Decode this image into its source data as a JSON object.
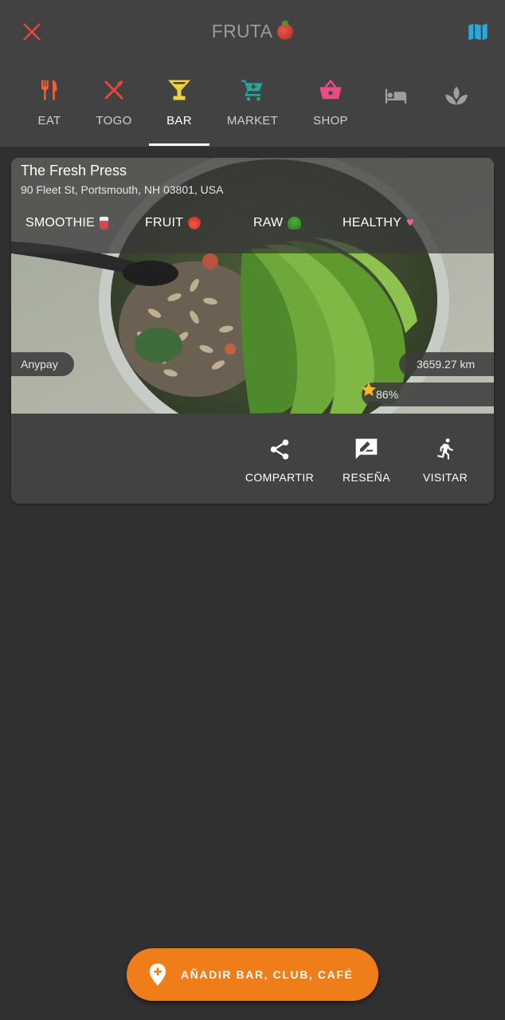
{
  "header": {
    "title": "FRUTA",
    "close_icon": "close-icon",
    "map_icon": "map-icon"
  },
  "tabs": [
    {
      "label": "EAT",
      "icon": "fork-knife-icon",
      "color": "#f0613a",
      "active": false
    },
    {
      "label": "TOGO",
      "icon": "fork-spoon-icon",
      "color": "#e8473b",
      "active": false
    },
    {
      "label": "BAR",
      "icon": "cocktail-icon",
      "color": "#f0d33a",
      "active": true
    },
    {
      "label": "MARKET",
      "icon": "cart-icon",
      "color": "#26a69a",
      "active": false
    },
    {
      "label": "SHOP",
      "icon": "basket-icon",
      "color": "#e94b86",
      "active": false
    },
    {
      "label": "",
      "icon": "bed-icon",
      "color": "#9e9e9e",
      "active": false
    },
    {
      "label": "",
      "icon": "spa-icon",
      "color": "#9e9e9e",
      "active": false
    }
  ],
  "place": {
    "name": "The Fresh Press",
    "address": "90 Fleet St, Portsmouth, NH 03801, USA",
    "tags": [
      {
        "label": "SMOOTHIE",
        "emoji": "cup-with-straw"
      },
      {
        "label": "FRUIT",
        "emoji": "strawberry"
      },
      {
        "label": "RAW",
        "emoji": "broccoli"
      },
      {
        "label": "HEALTHY",
        "emoji": "heart"
      }
    ],
    "payment": "Anypay",
    "distance": "3659.27 km",
    "rating_stars": 4.5,
    "rating_text": "86%"
  },
  "actions": [
    {
      "label": "COMPARTIR",
      "icon": "share-icon"
    },
    {
      "label": "RESEÑA",
      "icon": "rate-review-icon"
    },
    {
      "label": "VISITAR",
      "icon": "directions-run-icon"
    }
  ],
  "fab": {
    "label": "AÑADIR BAR, CLUB, CAFÉ",
    "icon": "add-location-icon"
  },
  "colors": {
    "background": "#303030",
    "surface": "#424242",
    "accent": "#ef7d1a",
    "star": "#f5b82e",
    "map": "#29a9e1",
    "close": "#e8473b"
  }
}
